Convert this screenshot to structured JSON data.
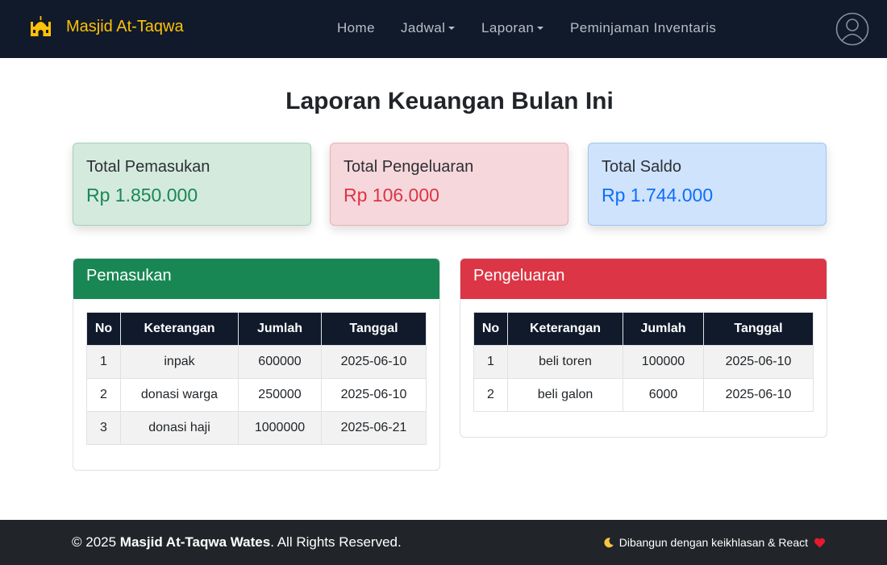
{
  "navbar": {
    "brand": "Masjid At-Taqwa",
    "links": {
      "home": "Home",
      "jadwal": "Jadwal",
      "laporan": "Laporan",
      "peminjaman": "Peminjaman Inventaris"
    }
  },
  "page": {
    "title": "Laporan Keuangan Bulan Ini"
  },
  "summary": {
    "income": {
      "label": "Total Pemasukan",
      "value": "Rp 1.850.000"
    },
    "expense": {
      "label": "Total Pengeluaran",
      "value": "Rp 106.000"
    },
    "balance": {
      "label": "Total Saldo",
      "value": "Rp 1.744.000"
    }
  },
  "income_table": {
    "title": "Pemasukan",
    "headers": [
      "No",
      "Keterangan",
      "Jumlah",
      "Tanggal"
    ],
    "rows": [
      [
        "1",
        "inpak",
        "600000",
        "2025-06-10"
      ],
      [
        "2",
        "donasi warga",
        "250000",
        "2025-06-10"
      ],
      [
        "3",
        "donasi haji",
        "1000000",
        "2025-06-21"
      ]
    ]
  },
  "expense_table": {
    "title": "Pengeluaran",
    "headers": [
      "No",
      "Keterangan",
      "Jumlah",
      "Tanggal"
    ],
    "rows": [
      [
        "1",
        "beli toren",
        "100000",
        "2025-06-10"
      ],
      [
        "2",
        "beli galon",
        "6000",
        "2025-06-10"
      ]
    ]
  },
  "footer": {
    "copyright_prefix": "© 2025 ",
    "org": "Masjid At-Taqwa Wates",
    "copyright_suffix": ". All Rights Reserved.",
    "built_with": "Dibangun dengan keikhlasan & React"
  },
  "icons": {
    "brand": "mosque-icon",
    "avatar": "user-circle-icon",
    "moon": "crescent-moon-icon",
    "heart": "heart-icon"
  },
  "colors": {
    "navbar_bg": "#101a2b",
    "brand": "#ffc107",
    "income": "#198754",
    "expense": "#dc3545",
    "balance": "#0d6efd",
    "footer_bg": "#212529"
  }
}
